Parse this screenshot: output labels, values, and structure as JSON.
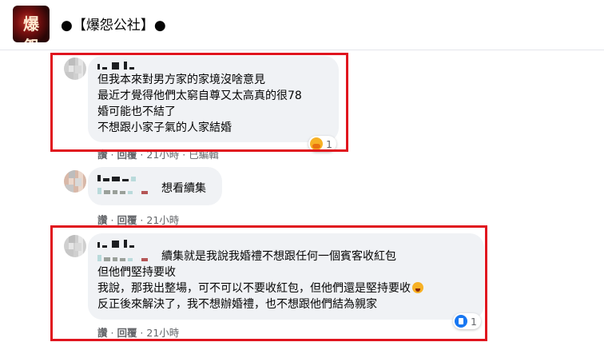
{
  "header": {
    "page_title": "●【爆怨公社】●",
    "avatar_glyph": "爆怨"
  },
  "comments": [
    {
      "lines": [
        "但我本來對男方家的家境沒啥意見",
        "最近才覺得他們太窮自尊又太高真的很78",
        "婚可能也不結了",
        "不想跟小家子氣的人家結婚"
      ],
      "meta_like": "讚",
      "meta_reply": "回覆",
      "meta_time": "21小時",
      "meta_edited": "已編輯",
      "reaction_count": "1",
      "reaction_icon": "care-emoji-icon"
    },
    {
      "text": "想看續集",
      "meta_like": "讚",
      "meta_reply": "回覆",
      "meta_time": "21小時"
    },
    {
      "first_line": "續集就是我說我婚禮不想跟任何一個賓客收紅包",
      "lines": [
        "但他們堅持要收",
        "我說，那我出整場，可不可以不要收紅包，但他們還是堅持要收",
        "反正後來解決了，我不想辦婚禮，也不想跟他們結為親家"
      ],
      "meta_like": "讚",
      "meta_reply": "回覆",
      "meta_time": "21小時",
      "reaction_count": "1",
      "reaction_icon": "like-icon"
    }
  ],
  "colors": {
    "highlight": "#e0141e",
    "bubble": "#f0f2f5",
    "meta_text": "#65676b"
  }
}
